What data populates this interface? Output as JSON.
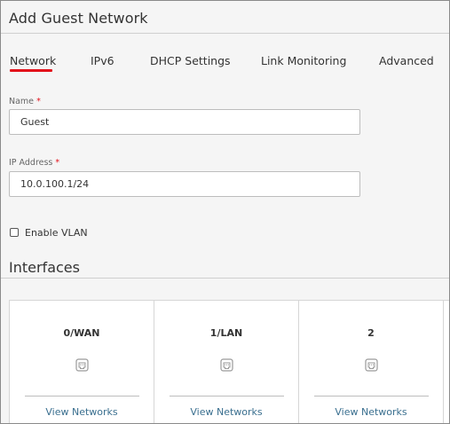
{
  "dialog": {
    "title": "Add Guest Network"
  },
  "tabs": [
    {
      "label": "Network",
      "active": true
    },
    {
      "label": "IPv6",
      "active": false
    },
    {
      "label": "DHCP Settings",
      "active": false
    },
    {
      "label": "Link Monitoring",
      "active": false
    },
    {
      "label": "Advanced",
      "active": false
    }
  ],
  "form": {
    "name": {
      "label": "Name",
      "required_mark": "*",
      "value": "Guest"
    },
    "ip_address": {
      "label": "IP Address",
      "required_mark": "*",
      "value": "10.0.100.1/24"
    },
    "enable_vlan": {
      "label": "Enable VLAN",
      "checked": false
    }
  },
  "interfaces": {
    "title": "Interfaces",
    "cards": [
      {
        "name": "0/WAN",
        "icon": "ethernet-port-icon",
        "link": "View Networks"
      },
      {
        "name": "1/LAN",
        "icon": "ethernet-port-icon",
        "link": "View Networks"
      },
      {
        "name": "2",
        "icon": "ethernet-port-icon",
        "link": "View Networks"
      }
    ]
  },
  "colors": {
    "accent": "#e3101a",
    "link": "#3a6f8f",
    "background": "#f5f5f5"
  }
}
